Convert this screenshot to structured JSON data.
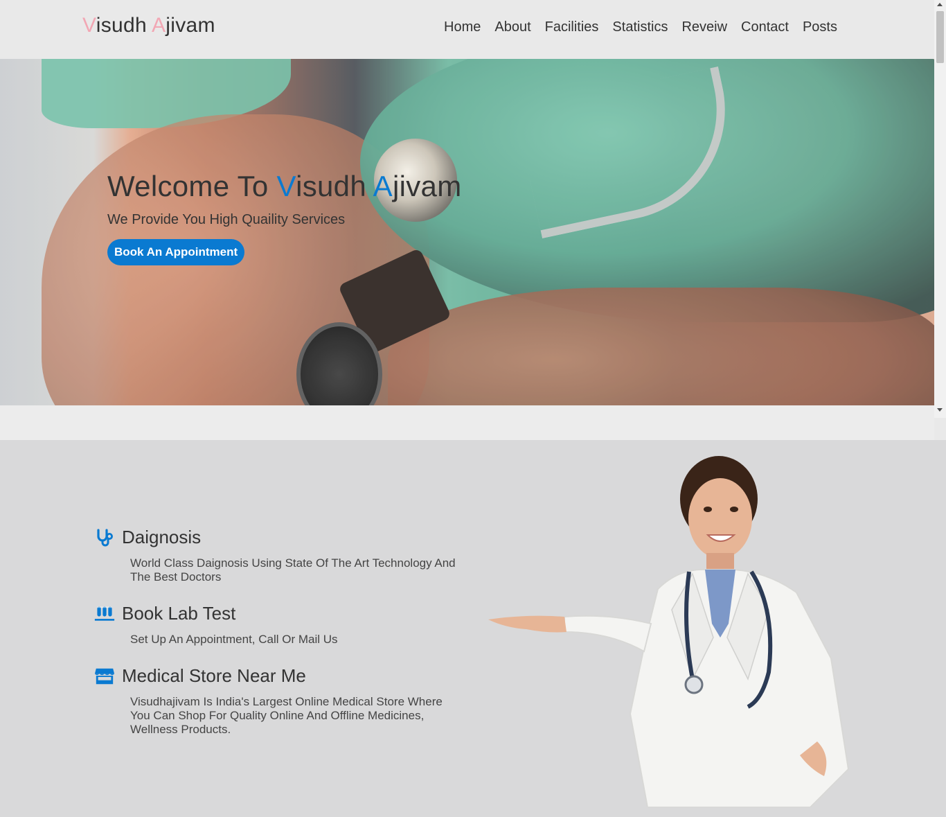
{
  "brand": {
    "first_initial": "V",
    "first_rest": "isudh ",
    "second_initial": "A",
    "second_rest": "jivam"
  },
  "nav": {
    "items": [
      "Home",
      "About",
      "Facilities",
      "Statistics",
      "Reveiw",
      "Contact",
      "Posts"
    ]
  },
  "hero": {
    "title_prefix": "Welcome To ",
    "title_v": "V",
    "title_isudh": "isudh ",
    "title_a": "A",
    "title_jivam": "jivam",
    "subtitle": "We Provide You High Quaility Services",
    "cta_label": "Book An Appointment"
  },
  "features": [
    {
      "icon": "stethoscope-icon",
      "title": "Daignosis",
      "description": "World Class Daignosis Using State Of The Art Technology And The Best Doctors"
    },
    {
      "icon": "test-tubes-icon",
      "title": "Book Lab Test",
      "description": "Set Up An Appointment, Call Or Mail Us"
    },
    {
      "icon": "store-icon",
      "title": "Medical Store Near Me",
      "description": "Visudhajivam Is India's Largest Online Medical Store Where You Can Shop For Quality Online And Offline Medicines, Wellness Products."
    }
  ],
  "colors": {
    "accent_blue": "#0a7ad1",
    "logo_pink": "#f2a7b4"
  }
}
